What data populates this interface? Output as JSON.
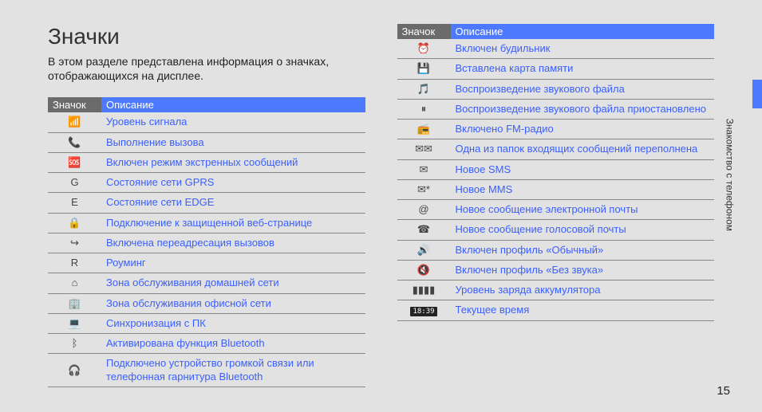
{
  "title": "Значки",
  "intro": "В этом разделе представлена информация о значках, отображающихся на дисплее.",
  "side_label": "Знакомство с телефоном",
  "page_number": "15",
  "header_icon": "Значок",
  "header_desc": "Описание",
  "tables": {
    "left": [
      {
        "icon": "signal-icon",
        "glyph": "📶",
        "desc": "Уровень сигнала"
      },
      {
        "icon": "call-icon",
        "glyph": "📞",
        "desc": "Выполнение вызова"
      },
      {
        "icon": "sos-icon",
        "glyph": "🆘",
        "desc": "Включен режим экстренных сообщений"
      },
      {
        "icon": "gprs-icon",
        "glyph": "G",
        "desc": "Состояние сети GPRS"
      },
      {
        "icon": "edge-icon",
        "glyph": "E",
        "desc": "Состояние сети EDGE"
      },
      {
        "icon": "secure-web-icon",
        "glyph": "🔒",
        "desc": "Подключение к защищенной веб-странице"
      },
      {
        "icon": "call-forward-icon",
        "glyph": "↪",
        "desc": "Включена переадресация вызовов"
      },
      {
        "icon": "roaming-icon",
        "glyph": "R",
        "desc": "Роуминг"
      },
      {
        "icon": "home-zone-icon",
        "glyph": "⌂",
        "desc": "Зона обслуживания домашней сети"
      },
      {
        "icon": "office-zone-icon",
        "glyph": "🏢",
        "desc": "Зона обслуживания офисной сети"
      },
      {
        "icon": "pc-sync-icon",
        "glyph": "💻",
        "desc": "Синхронизация с ПК"
      },
      {
        "icon": "bluetooth-icon",
        "glyph": "ᛒ",
        "desc": "Активирована функция Bluetooth"
      },
      {
        "icon": "bt-headset-icon",
        "glyph": "🎧",
        "desc": "Подключено устройство громкой связи или телефонная гарнитура Bluetooth"
      }
    ],
    "right": [
      {
        "icon": "alarm-icon",
        "glyph": "⏰",
        "desc": "Включен будильник"
      },
      {
        "icon": "memory-card-icon",
        "glyph": "💾",
        "desc": "Вставлена карта памяти"
      },
      {
        "icon": "audio-play-icon",
        "glyph": "🎵",
        "desc": "Воспроизведение звукового файла"
      },
      {
        "icon": "audio-pause-icon",
        "glyph": "⏸",
        "desc": "Воспроизведение звукового файла приостановлено"
      },
      {
        "icon": "fm-radio-icon",
        "glyph": "📻",
        "desc": "Включено FM-радио"
      },
      {
        "icon": "inbox-full-icon",
        "glyph": "✉✉",
        "desc": "Одна из папок входящих сообщений переполнена"
      },
      {
        "icon": "sms-icon",
        "glyph": "✉",
        "desc": "Новое SMS"
      },
      {
        "icon": "mms-icon",
        "glyph": "✉*",
        "desc": "Новое MMS"
      },
      {
        "icon": "email-icon",
        "glyph": "@",
        "desc": "Новое сообщение электронной почты"
      },
      {
        "icon": "voicemail-icon",
        "glyph": "☎",
        "desc": "Новое сообщение голосовой почты"
      },
      {
        "icon": "profile-normal-icon",
        "glyph": "🔊",
        "desc": "Включен профиль «Обычный»"
      },
      {
        "icon": "profile-silent-icon",
        "glyph": "🔇",
        "desc": "Включен профиль «Без звука»"
      },
      {
        "icon": "battery-icon",
        "glyph": "▮▮▮▮",
        "desc": "Уровень заряда аккумулятора"
      },
      {
        "icon": "clock-time-icon",
        "glyph": "18:39",
        "desc": "Текущее время",
        "time_style": true
      }
    ]
  }
}
